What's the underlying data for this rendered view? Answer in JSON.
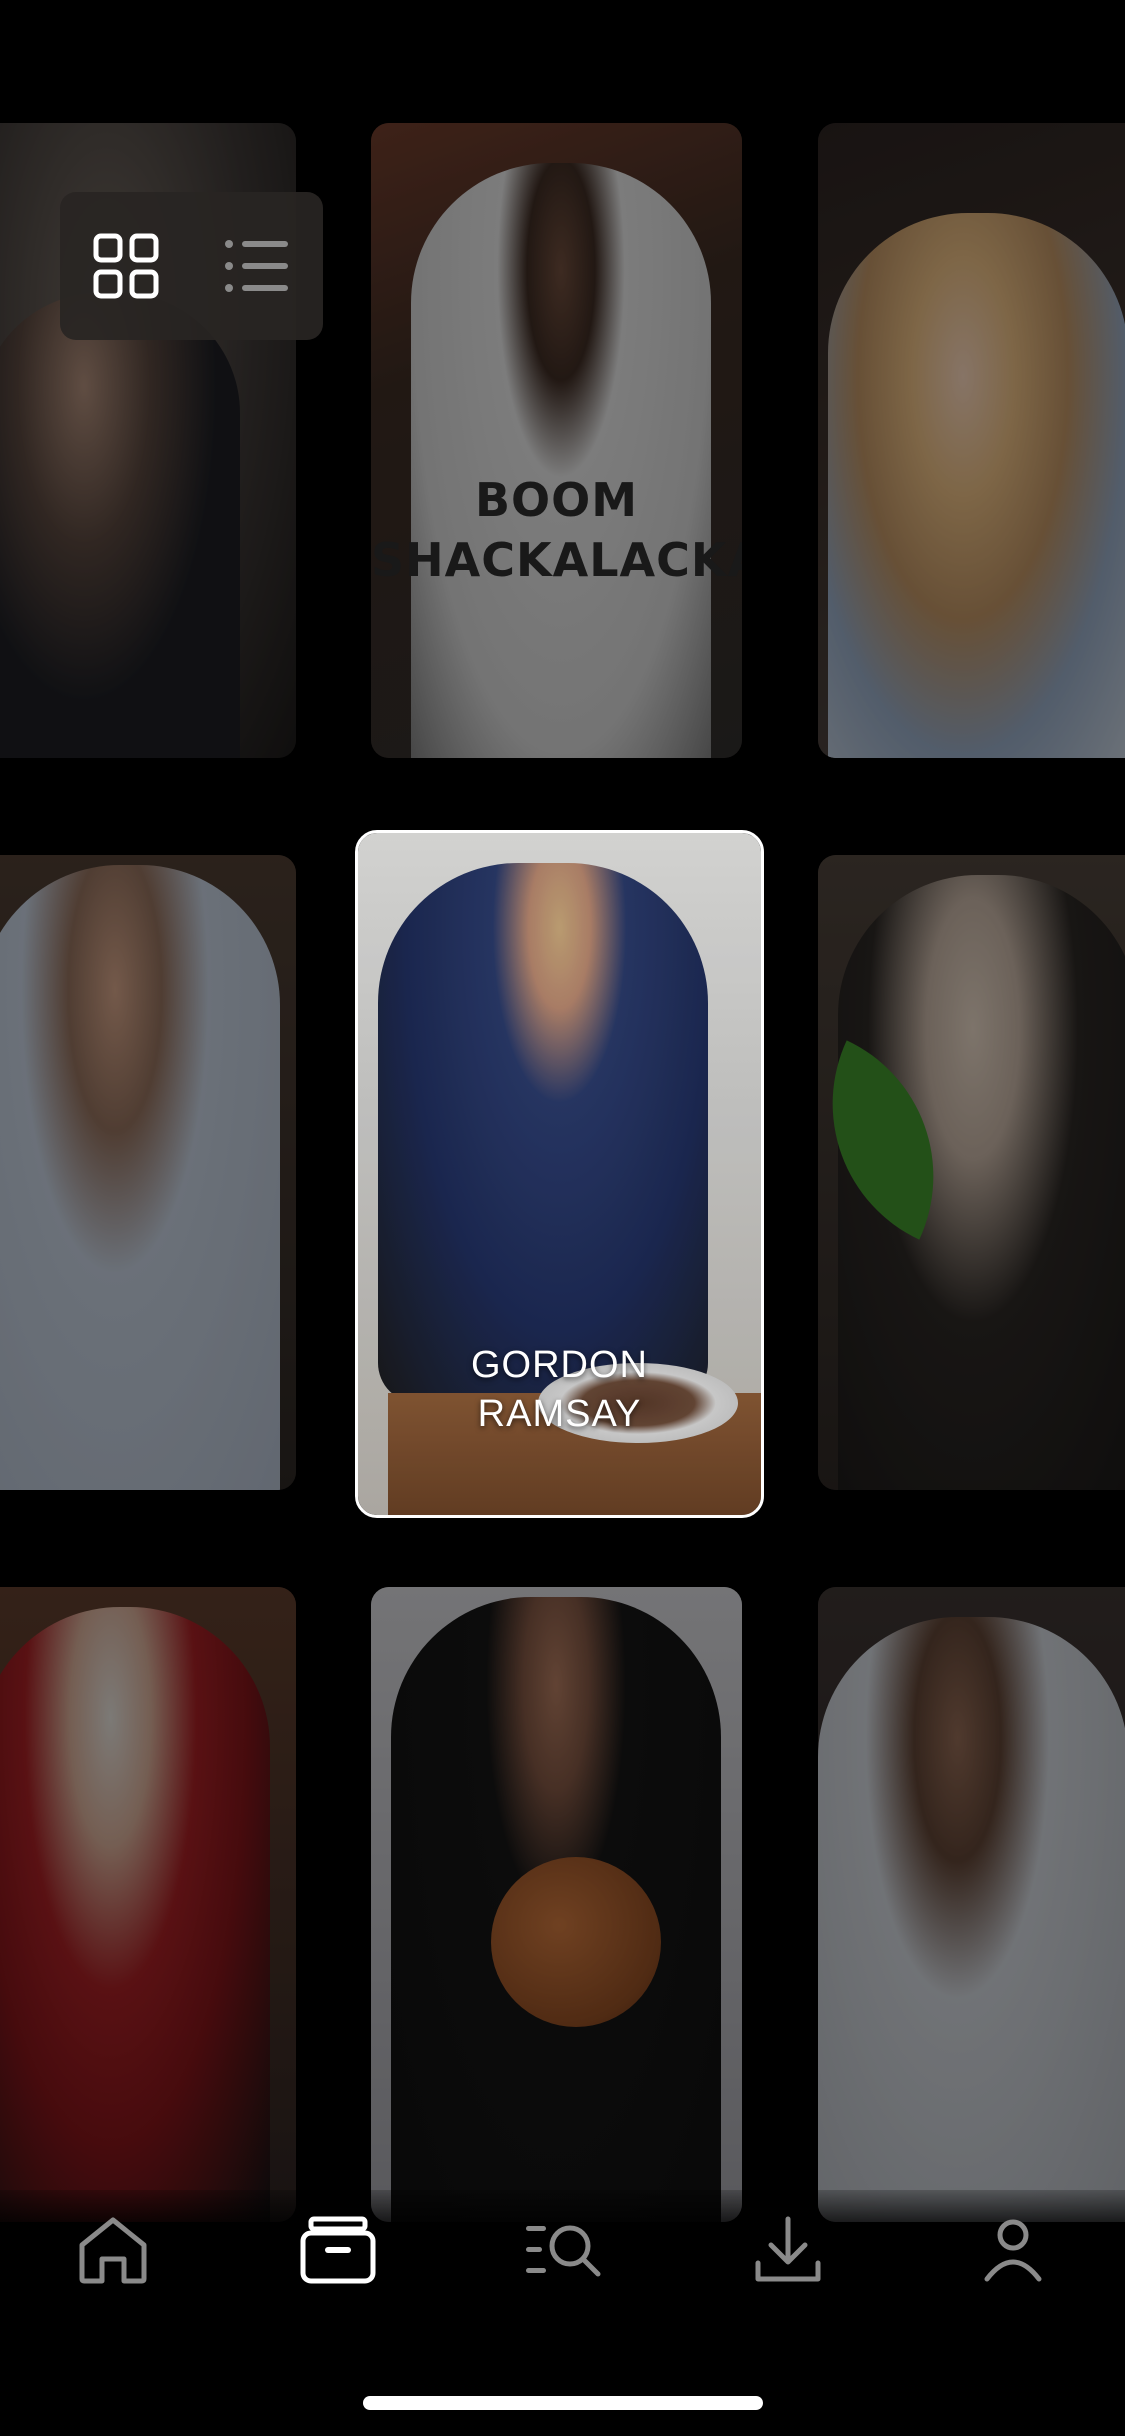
{
  "view_toggle": {
    "grid_icon": "grid-icon",
    "list_icon": "list-icon"
  },
  "cards": {
    "featured_name_line1": "GORDON",
    "featured_name_line2": "RAMSAY",
    "shirt_line1": "BOOM",
    "shirt_line2": "SHACKALACKA"
  },
  "nav": {
    "items": [
      "home-icon",
      "library-icon",
      "search-list-icon",
      "download-icon",
      "profile-icon"
    ],
    "active": "library-icon"
  },
  "colors": {
    "background": "#000000",
    "toggle_bg": "#282523",
    "active_icon": "#ffffff",
    "inactive_icon": "#8a8a8a"
  }
}
